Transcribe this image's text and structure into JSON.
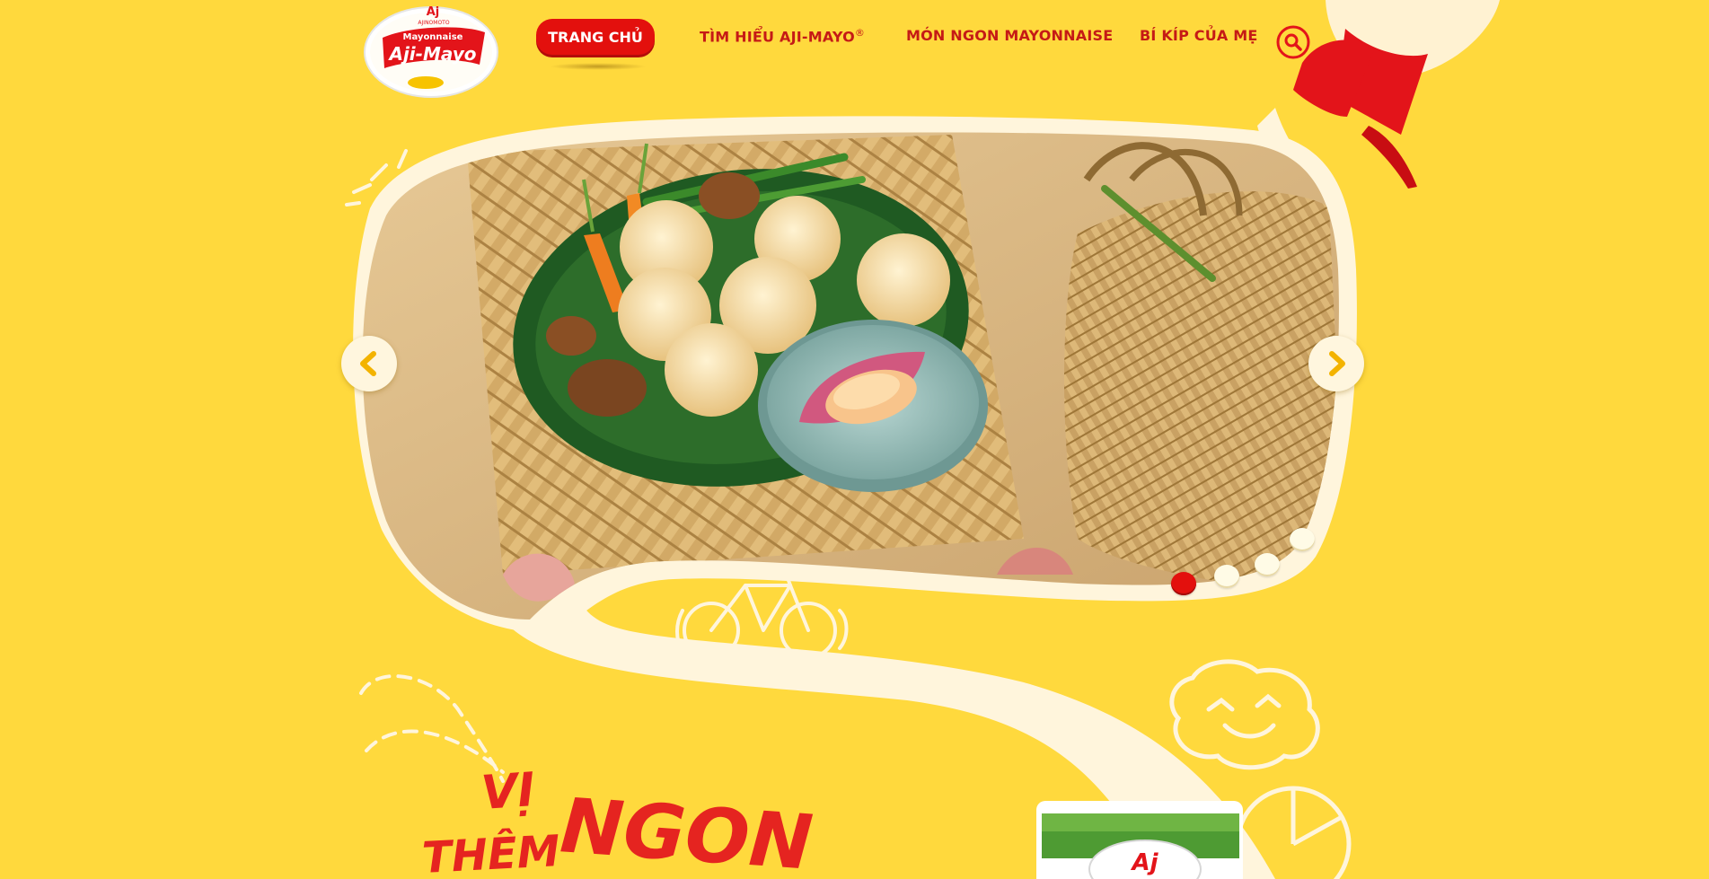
{
  "brand": {
    "logo_top": "Aj",
    "logo_sub": "AJINOMOTO",
    "logo_line1": "Mayonnaise",
    "logo_line2": "Aji-Mayo"
  },
  "nav": {
    "home": "TRANG CHỦ",
    "about": "TÌM HIỂU AJI-MAYO",
    "about_mark": "®",
    "recipes": "MÓN NGON MAYONNAISE",
    "tips": "BÍ KÍP CỦA MẸ"
  },
  "slider": {
    "dots": [
      true,
      false,
      false,
      false
    ]
  },
  "headline": {
    "line1": "VỊ",
    "line2": "THÊM",
    "line3": "NGON"
  },
  "package": {
    "logo": "Aj"
  },
  "colors": {
    "background": "#ffd93d",
    "brand_red": "#e3100d",
    "cream": "#fff6de"
  }
}
